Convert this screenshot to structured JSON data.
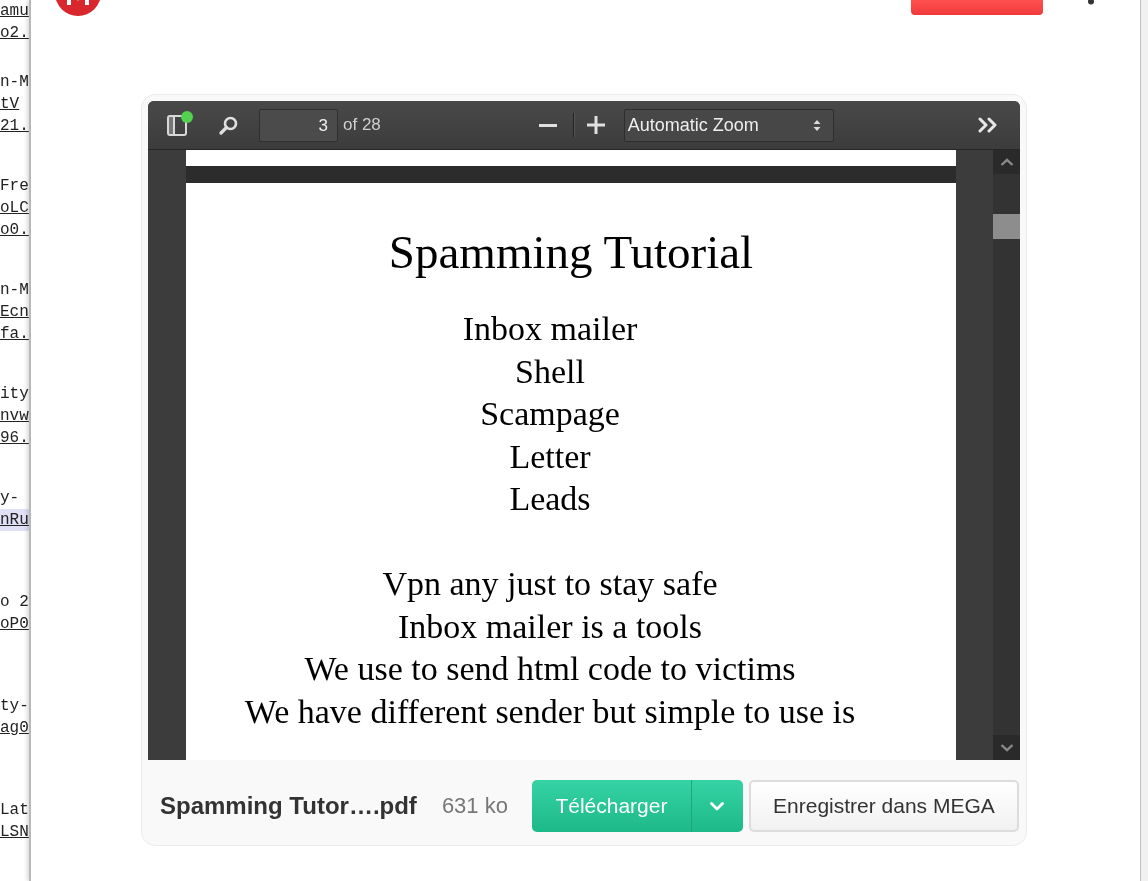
{
  "background_listing": [
    {
      "lines": [
        {
          "text": "amu",
          "kind": "link",
          "highlighted": false
        },
        {
          "text": "o2.",
          "kind": "link",
          "highlighted": false
        }
      ]
    },
    {
      "lines": [
        {
          "text": "n-M",
          "kind": "text",
          "highlighted": false
        },
        {
          "text": "tV",
          "kind": "link",
          "highlighted": false
        },
        {
          "text": "21.",
          "kind": "link",
          "highlighted": false
        }
      ]
    },
    {
      "lines": [
        {
          "text": "Fre",
          "kind": "text",
          "highlighted": false
        },
        {
          "text": "oLC",
          "kind": "link",
          "highlighted": false
        },
        {
          "text": "o0.",
          "kind": "link",
          "highlighted": false
        }
      ]
    },
    {
      "lines": [
        {
          "text": "n-M",
          "kind": "text",
          "highlighted": false
        },
        {
          "text": "Ecn",
          "kind": "link",
          "highlighted": false
        },
        {
          "text": "fa.",
          "kind": "link",
          "highlighted": false
        }
      ]
    },
    {
      "lines": [
        {
          "text": "ity",
          "kind": "text",
          "highlighted": false
        },
        {
          "text": "nvw",
          "kind": "link",
          "highlighted": false
        },
        {
          "text": "96.",
          "kind": "link",
          "highlighted": false
        }
      ]
    },
    {
      "lines": [
        {
          "text": "y-",
          "kind": "text",
          "highlighted": false
        },
        {
          "text": "nRu",
          "kind": "link",
          "highlighted": true
        }
      ]
    },
    {
      "lines": [
        {
          "text": "o 2",
          "kind": "text",
          "highlighted": false
        },
        {
          "text": "oP0",
          "kind": "link",
          "highlighted": false
        }
      ]
    },
    {
      "lines": [
        {
          "text": "ty-",
          "kind": "text",
          "highlighted": false
        },
        {
          "text": "ag0",
          "kind": "link",
          "highlighted": false
        }
      ]
    },
    {
      "lines": [
        {
          "text": "Lat",
          "kind": "text",
          "highlighted": false
        },
        {
          "text": "LSN",
          "kind": "link",
          "highlighted": false
        }
      ]
    }
  ],
  "pdf_viewer": {
    "page_number": "3",
    "page_count": "of 28",
    "zoom": "Automatic Zoom",
    "page": {
      "title": "Spamming Tutorial",
      "paragraphs": [
        [
          "Inbox mailer",
          "Shell",
          "Scampage",
          "Letter",
          "Leads"
        ],
        [
          "Vpn any just to stay safe",
          "Inbox mailer is a tools",
          "We use to send html code to victims",
          "We have different sender but simple to use is"
        ]
      ]
    }
  },
  "file": {
    "name": "Spamming Tutor….pdf",
    "size": "631 ko"
  },
  "buttons": {
    "download": "Télécharger",
    "save": "Enregistrer dans MEGA"
  }
}
